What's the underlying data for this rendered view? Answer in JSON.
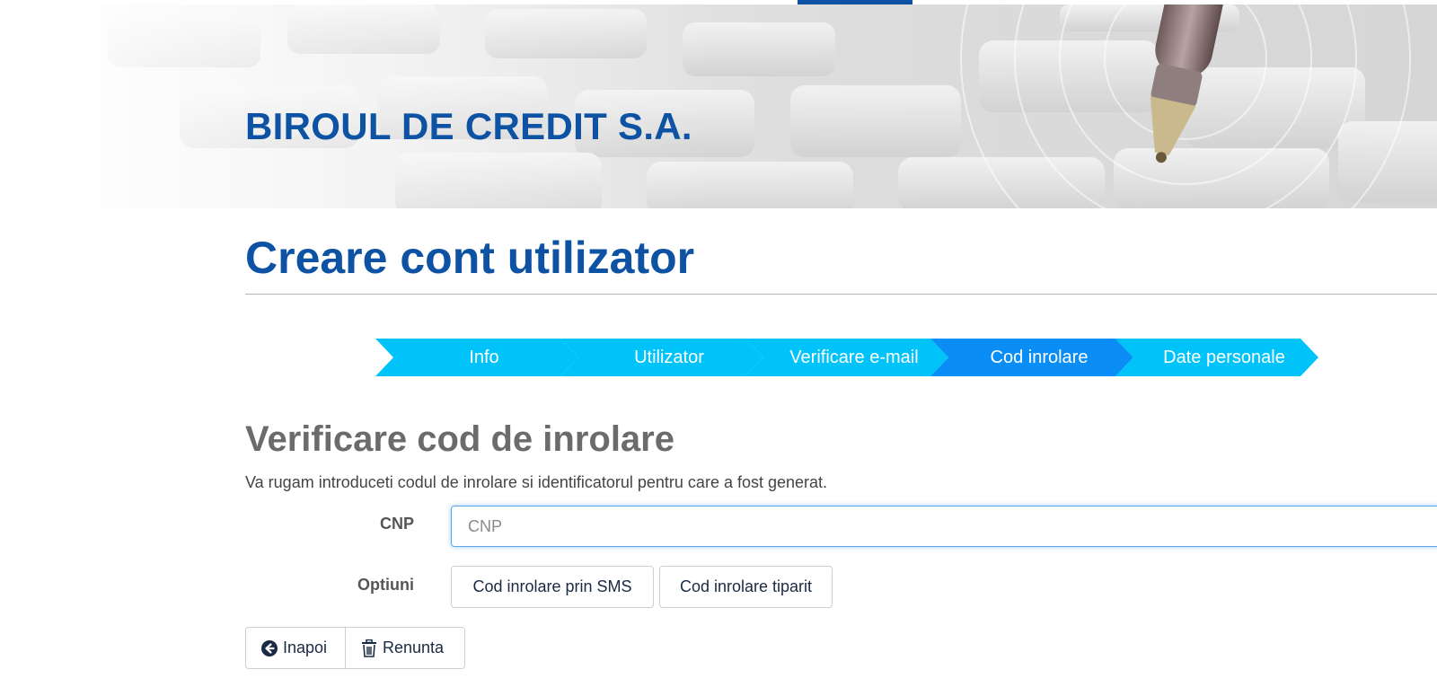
{
  "header": {
    "brand": "BIROUL DE CREDIT S.A."
  },
  "page": {
    "title": "Creare cont utilizator"
  },
  "wizard": {
    "steps": [
      {
        "label": "Info",
        "active": false
      },
      {
        "label": "Utilizator",
        "active": false
      },
      {
        "label": "Verificare e-mail",
        "active": false
      },
      {
        "label": "Cod inrolare",
        "active": true
      },
      {
        "label": "Date personale",
        "active": false
      }
    ]
  },
  "section": {
    "title": "Verificare cod de inrolare",
    "description": "Va rugam introduceti codul de inrolare si identificatorul pentru care a fost generat."
  },
  "form": {
    "cnp_label": "CNP",
    "cnp_placeholder": "CNP",
    "cnp_value": "",
    "options_label": "Optiuni",
    "option_sms": "Cod inrolare prin SMS",
    "option_print": "Cod inrolare tiparit"
  },
  "actions": {
    "back_label": "Inapoi",
    "back_icon": "arrow-circle-left-icon",
    "cancel_label": "Renunta",
    "cancel_icon": "trash-icon"
  },
  "colors": {
    "brand_blue": "#0d52a3",
    "step_color": "#00c3fa",
    "step_active": "#0a8ef5"
  }
}
